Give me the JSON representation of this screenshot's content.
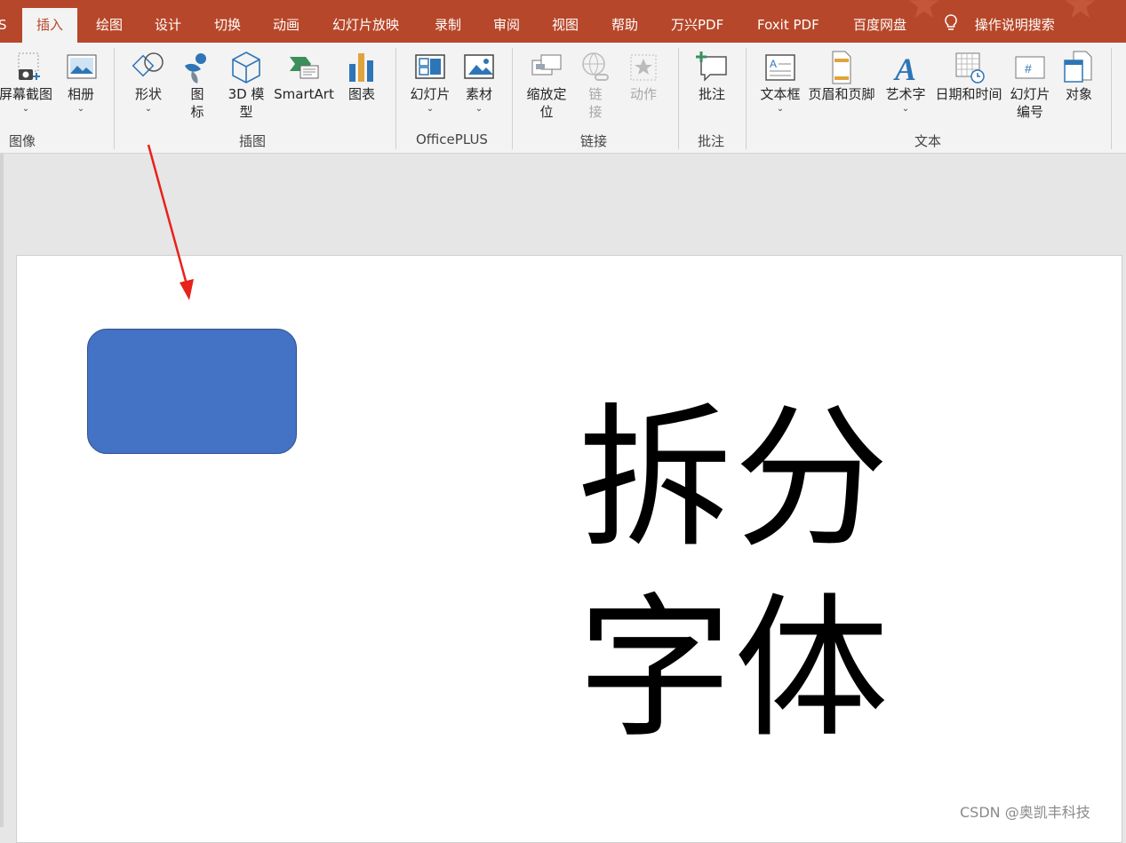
{
  "tabs": [
    {
      "label": "S",
      "active": false
    },
    {
      "label": "插入",
      "active": true
    },
    {
      "label": "绘图",
      "active": false
    },
    {
      "label": "设计",
      "active": false
    },
    {
      "label": "切换",
      "active": false
    },
    {
      "label": "动画",
      "active": false
    },
    {
      "label": "幻灯片放映",
      "active": false
    },
    {
      "label": "录制",
      "active": false
    },
    {
      "label": "审阅",
      "active": false
    },
    {
      "label": "视图",
      "active": false
    },
    {
      "label": "帮助",
      "active": false
    },
    {
      "label": "万兴PDF",
      "active": false
    },
    {
      "label": "Foxit PDF",
      "active": false
    },
    {
      "label": "百度网盘",
      "active": false
    }
  ],
  "tell_me": {
    "label": "操作说明搜索",
    "icon": "lightbulb-icon"
  },
  "ribbon": {
    "groups": {
      "images": "图像",
      "illustrations": "插图",
      "officeplus": "OfficePLUS",
      "links": "链接",
      "comments": "批注",
      "text": "文本"
    },
    "buttons": {
      "screenshot": {
        "label": "屏幕截图",
        "icon": "screenshot-icon"
      },
      "photo_album": {
        "label": "相册",
        "icon": "photo-album-icon"
      },
      "shapes": {
        "label": "形状",
        "icon": "shapes-icon"
      },
      "icons": {
        "line1": "图",
        "line2": "标",
        "icon": "icons-icon"
      },
      "models_3d": {
        "line1": "3D 模",
        "line2": "型",
        "icon": "cube-icon"
      },
      "smartart": {
        "label": "SmartArt",
        "icon": "smartart-icon"
      },
      "chart": {
        "label": "图表",
        "icon": "chart-icon"
      },
      "slides": {
        "label": "幻灯片",
        "icon": "slides-icon"
      },
      "material": {
        "label": "素材",
        "icon": "image-icon"
      },
      "zoom": {
        "line1": "缩放定",
        "line2": "位",
        "icon": "zoom-icon"
      },
      "link": {
        "line1": "链",
        "line2": "接",
        "icon": "link-icon"
      },
      "action": {
        "label": "动作",
        "icon": "star-icon"
      },
      "comment": {
        "label": "批注",
        "icon": "comment-icon"
      },
      "textbox": {
        "label": "文本框",
        "icon": "textbox-icon"
      },
      "header_footer": {
        "label": "页眉和页脚",
        "icon": "header-footer-icon"
      },
      "wordart": {
        "label": "艺术字",
        "icon": "wordart-icon"
      },
      "datetime": {
        "label": "日期和时间",
        "icon": "calendar-icon"
      },
      "slide_number": {
        "line1": "幻灯片",
        "line2": "编号",
        "icon": "slide-number-icon"
      },
      "object": {
        "label": "对象",
        "icon": "object-icon"
      }
    }
  },
  "slide": {
    "text_line1": "拆分",
    "text_line2": "字体",
    "shape_color": "#4472c4"
  },
  "watermark": "CSDN @奥凯丰科技",
  "colors": {
    "accent": "#b7472a",
    "annotation_arrow": "#e8211b"
  }
}
